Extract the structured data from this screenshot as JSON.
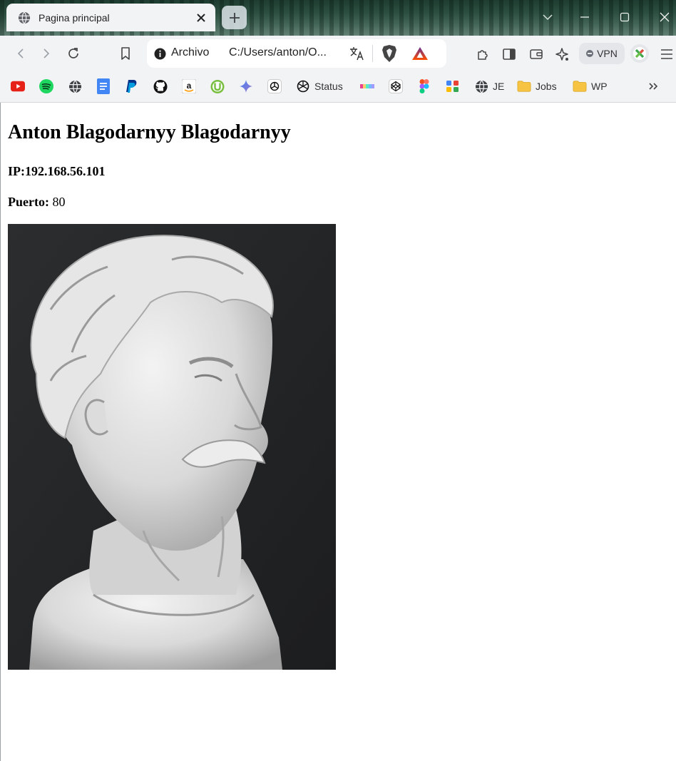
{
  "browser": {
    "tab": {
      "title": "Pagina principal"
    },
    "address": {
      "scheme": "Archivo",
      "url": "C:/Users/anton/O..."
    },
    "vpn_label": "VPN"
  },
  "bookmarks": [
    {
      "name": "youtube-bookmark",
      "label": "",
      "icon": "youtube-icon"
    },
    {
      "name": "spotify-bookmark",
      "label": "",
      "icon": "spotify-icon"
    },
    {
      "name": "globe-bookmark",
      "label": "",
      "icon": "globe-icon"
    },
    {
      "name": "docs-bookmark",
      "label": "",
      "icon": "docs-icon"
    },
    {
      "name": "paypal-bookmark",
      "label": "",
      "icon": "paypal-icon"
    },
    {
      "name": "github-bookmark",
      "label": "",
      "icon": "github-icon"
    },
    {
      "name": "amazon-bookmark",
      "label": "",
      "icon": "amazon-icon"
    },
    {
      "name": "utorrent-bookmark",
      "label": "",
      "icon": "utorrent-icon"
    },
    {
      "name": "gemini-bookmark",
      "label": "",
      "icon": "sparkle-icon"
    },
    {
      "name": "chatgpt-bookmark",
      "label": "",
      "icon": "openai-icon"
    },
    {
      "name": "status-bookmark",
      "label": "Status",
      "icon": "openai-icon"
    },
    {
      "name": "color-bookmark",
      "label": "",
      "icon": "colorbar-icon"
    },
    {
      "name": "codepen-bookmark",
      "label": "",
      "icon": "codepen-icon"
    },
    {
      "name": "figma-bookmark",
      "label": "",
      "icon": "figma-icon"
    },
    {
      "name": "apps-bookmark",
      "label": "",
      "icon": "blocks-icon"
    },
    {
      "name": "je-bookmark",
      "label": "JE",
      "icon": "globe-icon"
    },
    {
      "name": "jobs-folder",
      "label": "Jobs",
      "icon": "folder-icon"
    },
    {
      "name": "wp-folder",
      "label": "WP",
      "icon": "folder-icon"
    }
  ],
  "page": {
    "heading": "Anton Blagodarnyy Blagodarnyy",
    "ip_text": "IP:192.168.56.101",
    "port_label": "Puerto:",
    "port_value": "80",
    "image": {
      "subject": "marble bust sculpture"
    }
  },
  "colors": {
    "page_bg": "#ffffff",
    "chrome_bg": "#f2f3f5",
    "brave_orange": "#fb542b",
    "bat_triangle_top": "#662d91",
    "bat_triangle_bottom": "#ff5000"
  }
}
